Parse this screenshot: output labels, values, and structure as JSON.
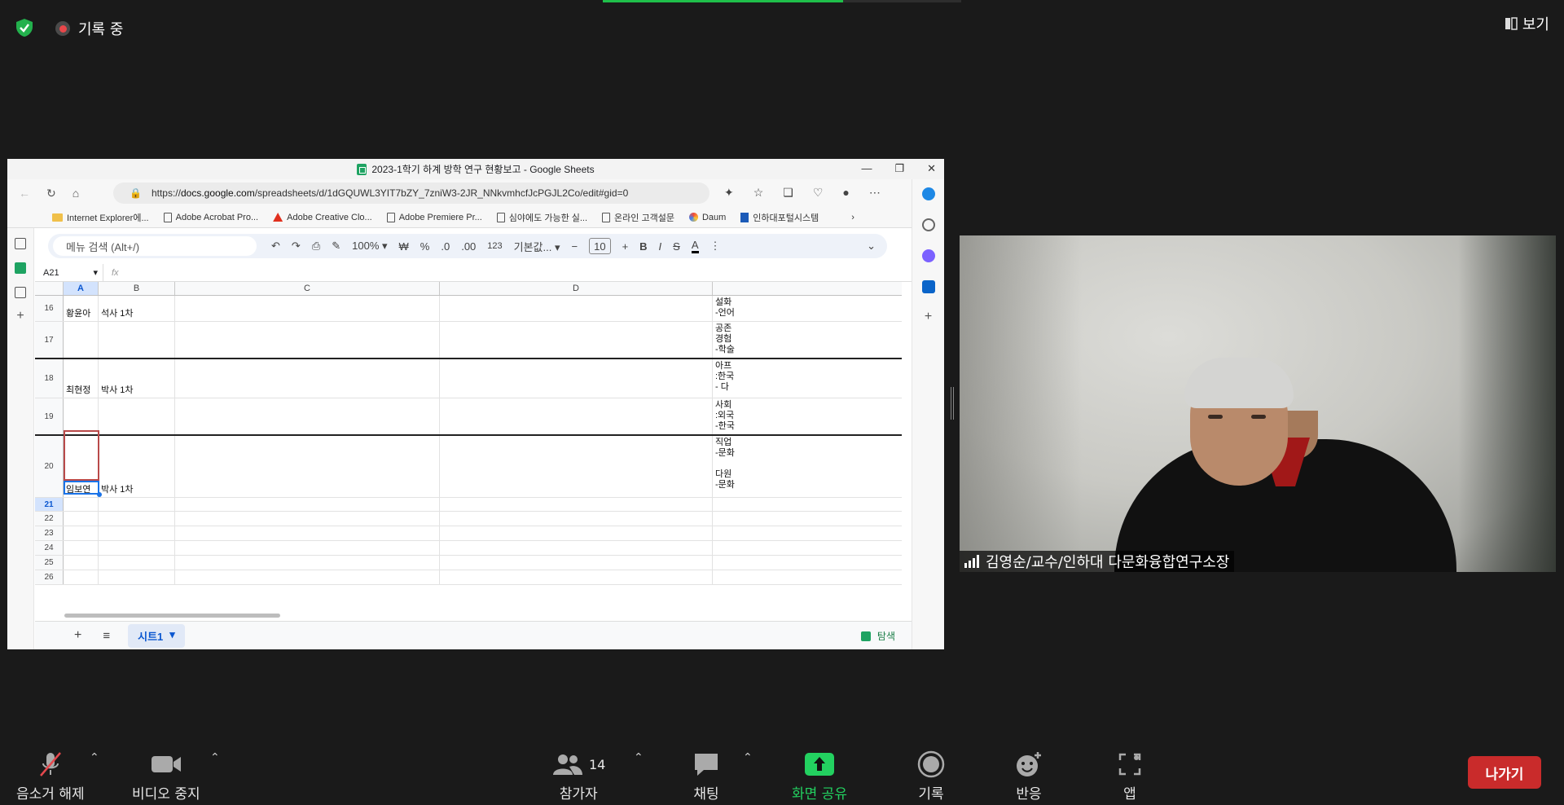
{
  "top": {
    "recording_label": "기록 중",
    "view_label": "보기"
  },
  "window": {
    "title": "2023-1학기 하계 방학 연구 현황보고 - Google Sheets",
    "url_prefix": "https://",
    "url_host": "docs.google.com",
    "url_path": "/spreadsheets/d/1dGQUWL3YIT7bZY_7zniW3-2JR_NNkvmhcfJcPGJL2Co/edit#gid=0",
    "bookmarks": [
      "Internet Explorer에...",
      "Adobe Acrobat Pro...",
      "Adobe Creative Clo...",
      "Adobe Premiere Pr...",
      "심야에도 가능한 실...",
      "온라인 고객설문",
      "Daum",
      "인하대포털시스템"
    ]
  },
  "sheet": {
    "menu_search_placeholder": "메뉴 검색 (Alt+/)",
    "zoom": "100%",
    "currency": "₩",
    "percent": "%",
    "dec_less": ".0",
    "dec_more": ".00",
    "num_format": "123",
    "font_name": "기본값...",
    "font_size": "10",
    "name_box": "A21",
    "fx": "fx",
    "columns": [
      "A",
      "B",
      "C",
      "D"
    ],
    "rows": [
      {
        "num": "16",
        "a": "황윤아",
        "b": "석사 1차",
        "d": "설화\n-언어"
      },
      {
        "num": "17",
        "a": "",
        "b": "",
        "d": "공존\n경험\n-학술"
      },
      {
        "num": "18",
        "a": "최현정",
        "b": "박사 1차",
        "d": "아프\n:한국\n- 다"
      },
      {
        "num": "19",
        "a": "",
        "b": "",
        "d": "사회\n:외국\n-한국"
      },
      {
        "num": "20",
        "a": "임보연",
        "b": "박사 1차",
        "d": "직업\n-문화\n\n다원\n-문화"
      },
      {
        "num": "21",
        "a": "",
        "b": "",
        "d": ""
      },
      {
        "num": "22",
        "a": "",
        "b": "",
        "d": ""
      },
      {
        "num": "23",
        "a": "",
        "b": "",
        "d": ""
      },
      {
        "num": "24",
        "a": "",
        "b": "",
        "d": ""
      },
      {
        "num": "25",
        "a": "",
        "b": "",
        "d": ""
      },
      {
        "num": "26",
        "a": "",
        "b": "",
        "d": ""
      }
    ],
    "sheet_tab": "시트1",
    "explore_label": "탐색"
  },
  "video": {
    "participant_name": "김영순/교수/인하대 다문화융합연구소장"
  },
  "controls": {
    "mute_label": "음소거 해제",
    "video_label": "비디오 중지",
    "participants_label": "참가자",
    "participants_count": "14",
    "chat_label": "채팅",
    "share_label": "화면 공유",
    "record_label": "기록",
    "reactions_label": "반응",
    "apps_label": "앱",
    "leave_label": "나가기"
  },
  "colors": {
    "zoom_bg": "#1a1a1a",
    "share_green": "#23d160",
    "leave_red": "#c92b2b",
    "sheets_green": "#1ea362"
  }
}
